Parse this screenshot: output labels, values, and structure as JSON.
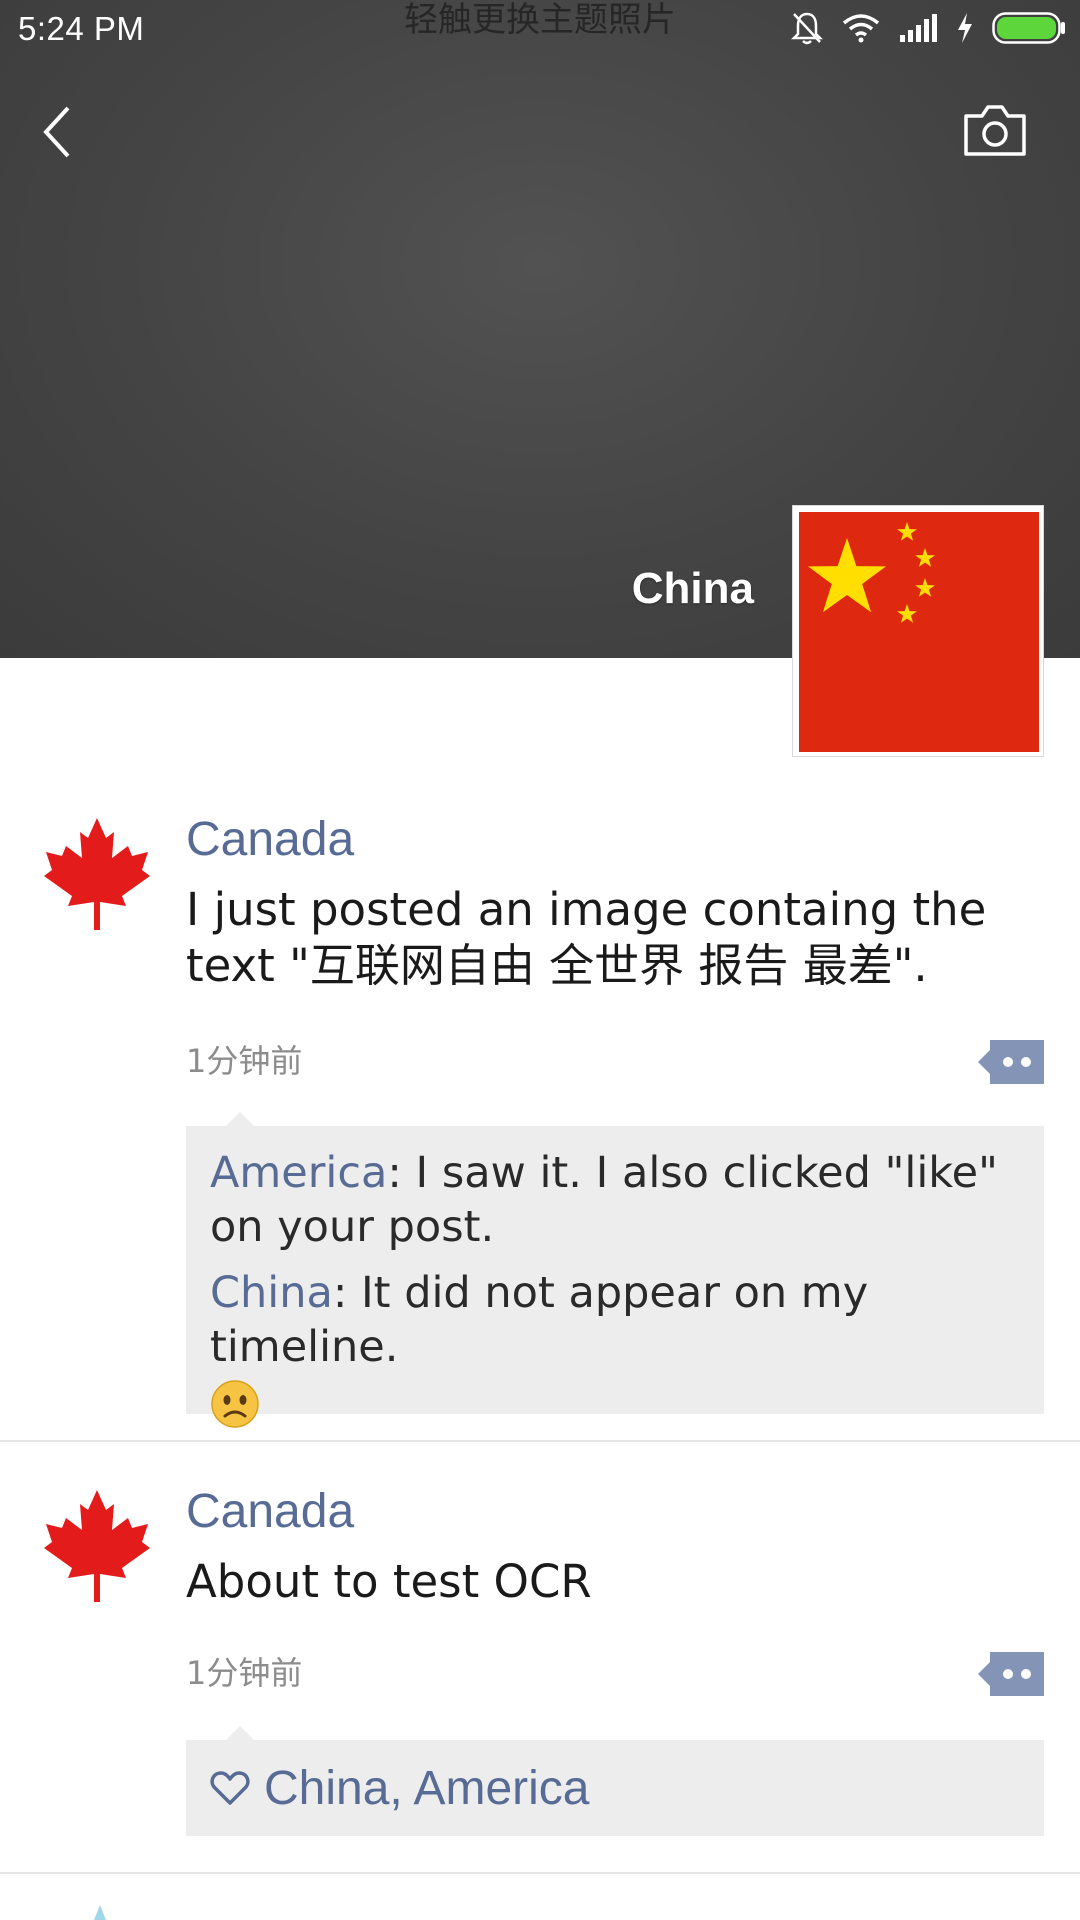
{
  "status_bar": {
    "time": "5:24 PM",
    "theme_hint": "轻触更换主题照片",
    "icons": [
      "mute-bell-icon",
      "wifi-icon",
      "signal-icon",
      "charging-icon",
      "battery-icon"
    ],
    "battery_color": "#5cd63a"
  },
  "header": {
    "back_icon": "chevron-left-icon",
    "camera_icon": "camera-icon",
    "profile_name": "China",
    "profile_avatar": "china-flag"
  },
  "colors": {
    "link": "#576b95",
    "reply_bg": "#ededed",
    "cover_bg": "#444444"
  },
  "posts": [
    {
      "author": "Canada",
      "avatar": "maple-leaf",
      "text": "I just posted an image containg the text \"互联网自由 全世界 报告 最差\".",
      "time": "1分钟前",
      "comments": [
        {
          "author": "America",
          "separator": ": ",
          "text": "I saw it. I also clicked \"like\" on your post."
        },
        {
          "author": "China",
          "separator": ": ",
          "text": "It did not appear on my timeline.",
          "emoji": "frown-emoji"
        }
      ]
    },
    {
      "author": "Canada",
      "avatar": "maple-leaf",
      "text": "About to test OCR",
      "time": "1分钟前",
      "likes": "China, America"
    }
  ]
}
